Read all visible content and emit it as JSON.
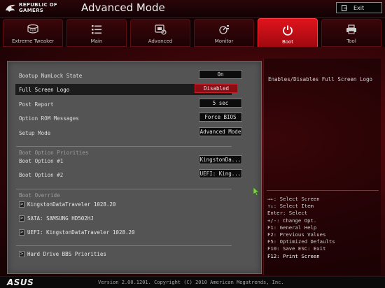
{
  "header": {
    "brand_line1": "REPUBLIC OF",
    "brand_line2": "GAMERS",
    "title": "Advanced Mode",
    "exit_label": "Exit"
  },
  "tabs": [
    {
      "label": "Extreme Tweaker",
      "icon": "extreme-tweaker-icon"
    },
    {
      "label": "Main",
      "icon": "list-icon"
    },
    {
      "label": "Advanced",
      "icon": "advanced-icon"
    },
    {
      "label": "Monitor",
      "icon": "monitor-icon"
    },
    {
      "label": "Boot",
      "icon": "power-icon",
      "active": true
    },
    {
      "label": "Tool",
      "icon": "printer-icon"
    }
  ],
  "settings": [
    {
      "label": "Bootup NumLock State",
      "value": "On"
    },
    {
      "label": "Full Screen Logo",
      "value": "Disabled",
      "selected": true
    },
    {
      "label": "Post Report",
      "value": "5 sec"
    },
    {
      "label": "Option ROM Messages",
      "value": "Force BIOS"
    },
    {
      "label": "Setup Mode",
      "value": "Advanced Mode"
    }
  ],
  "boot_priorities": {
    "heading": "Boot Option Priorities",
    "options": [
      {
        "label": "Boot Option #1",
        "value": "KingstonDa..."
      },
      {
        "label": "Boot Option #2",
        "value": "UEFI: King..."
      }
    ]
  },
  "boot_override": {
    "heading": "Boot Override",
    "items": [
      "KingstonDataTraveler 1028.20",
      "SATA: SAMSUNG HD502HJ",
      "UEFI: KingstonDataTraveler 1028.20"
    ]
  },
  "hard_drive_bbs": "Hard Drive BBS Priorities",
  "help": {
    "description": "Enables/Disables Full Screen Logo",
    "hotkeys": [
      "→←: Select Screen",
      "↑↓: Select Item",
      "Enter: Select",
      "+/-: Change Opt.",
      "F1: General Help",
      "F2: Previous Values",
      "F5: Optimized Defaults",
      "F10: Save  ESC: Exit",
      "F12: Print Screen"
    ]
  },
  "footer": {
    "brand": "ASUS",
    "version": "Version 2.00.1201. Copyright (C) 2010 American Megatrends, Inc."
  },
  "colors": {
    "accent": "#c4101a",
    "panel": "#545454",
    "background": "#120204"
  }
}
